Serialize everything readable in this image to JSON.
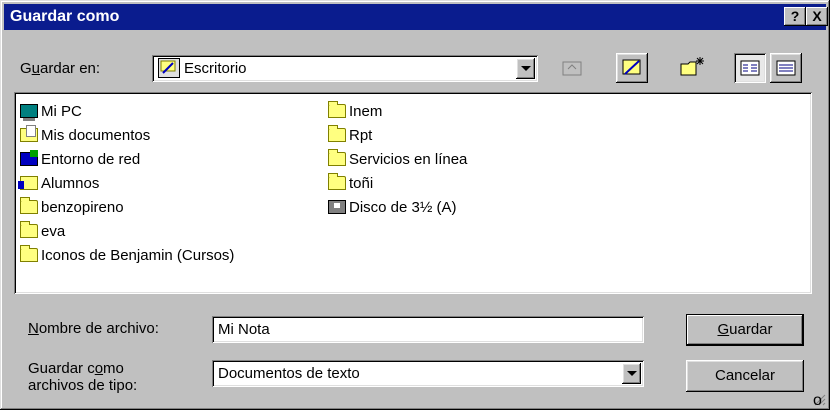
{
  "dialog": {
    "title": "Guardar como",
    "help_label": "?",
    "close_label": "X"
  },
  "save_in": {
    "label_pre": "G",
    "label_u": "u",
    "label_post": "ardar en:",
    "value": "Escritorio"
  },
  "toolbar": {
    "icons": [
      "up-folder-icon",
      "desktop-icon",
      "new-folder-icon",
      "list-view-icon",
      "details-view-icon"
    ]
  },
  "files": {
    "col1": [
      {
        "label": "Mi PC",
        "icon": "my-computer-icon"
      },
      {
        "label": "Mis documentos",
        "icon": "my-documents-icon"
      },
      {
        "label": "Entorno de red",
        "icon": "network-icon"
      },
      {
        "label": "Alumnos",
        "icon": "briefcase-icon"
      },
      {
        "label": "benzopireno",
        "icon": "folder-icon"
      },
      {
        "label": "eva",
        "icon": "folder-icon"
      },
      {
        "label": "Iconos de Benjamin (Cursos)",
        "icon": "folder-icon"
      }
    ],
    "col2": [
      {
        "label": "Inem",
        "icon": "folder-icon"
      },
      {
        "label": "Rpt",
        "icon": "folder-icon"
      },
      {
        "label": "Servicios en línea",
        "icon": "folder-icon"
      },
      {
        "label": "toñi",
        "icon": "folder-icon"
      },
      {
        "label": "Disco de 3½ (A)",
        "icon": "floppy-drive-icon"
      }
    ]
  },
  "filename": {
    "label_u": "N",
    "label_post": "ombre de archivo:",
    "value": "Mi Nota"
  },
  "filetype": {
    "label_line1_pre": "Guardar c",
    "label_line1_u": "o",
    "label_line1_post": "mo",
    "label_line2": "archivos de tipo:",
    "value": "Documentos de texto"
  },
  "buttons": {
    "save_u": "G",
    "save_post": "uardar",
    "cancel": "Cancelar"
  },
  "stray_char": "o"
}
